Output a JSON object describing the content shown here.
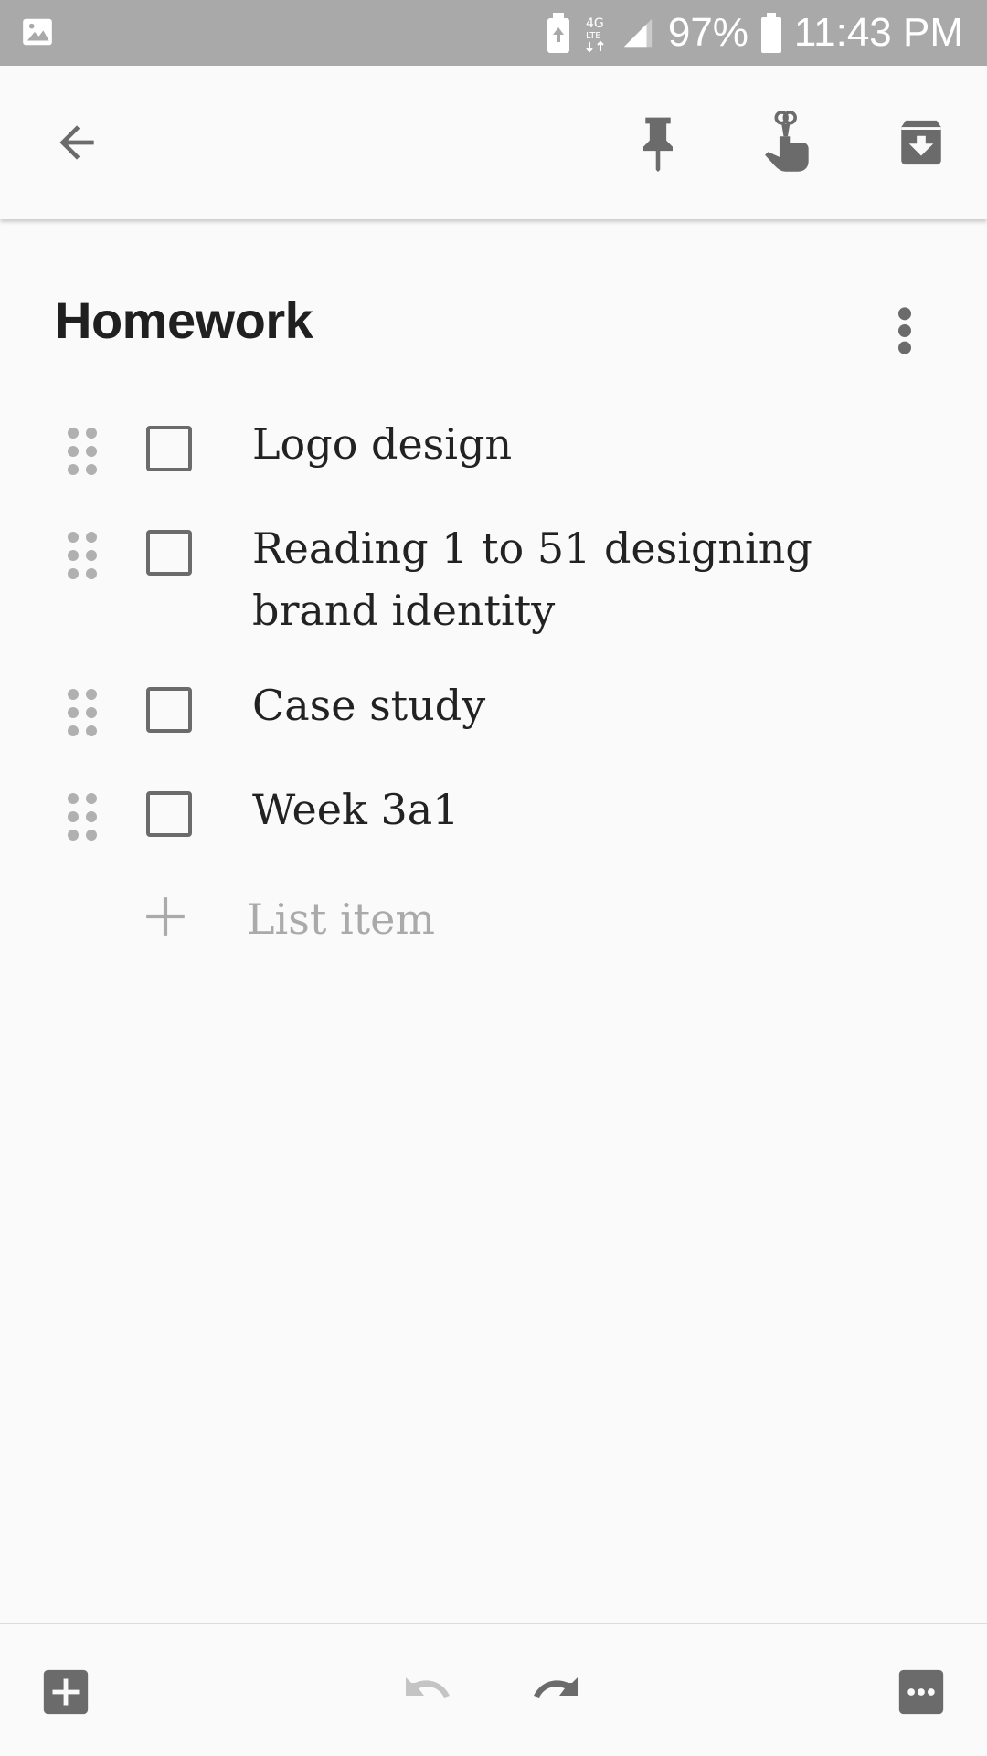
{
  "status_bar": {
    "battery_percent": "97%",
    "time": "11:43 PM",
    "network": "4G LTE",
    "icons": [
      "gallery-icon",
      "battery-saver-icon",
      "lte-icon",
      "signal-icon",
      "battery-icon"
    ]
  },
  "toolbar": {
    "icons": [
      "back-arrow-icon",
      "pin-icon",
      "reminder-icon",
      "archive-icon"
    ]
  },
  "note": {
    "title": "Homework",
    "items": [
      {
        "text": "Logo design",
        "checked": false
      },
      {
        "text": "Reading 1 to 51 designing brand identity",
        "checked": false
      },
      {
        "text": "Case study",
        "checked": false
      },
      {
        "text": "Week 3a1",
        "checked": false
      }
    ],
    "add_item_placeholder": "List item"
  },
  "bottom_bar": {
    "icons": [
      "add-box-icon",
      "undo-icon",
      "redo-icon",
      "more-horiz-icon"
    ]
  },
  "colors": {
    "status_bar_bg": "#a9a9a9",
    "background": "#fafafa",
    "icon": "#6b6b6b",
    "text": "#222222",
    "placeholder": "#aaaaaa"
  }
}
